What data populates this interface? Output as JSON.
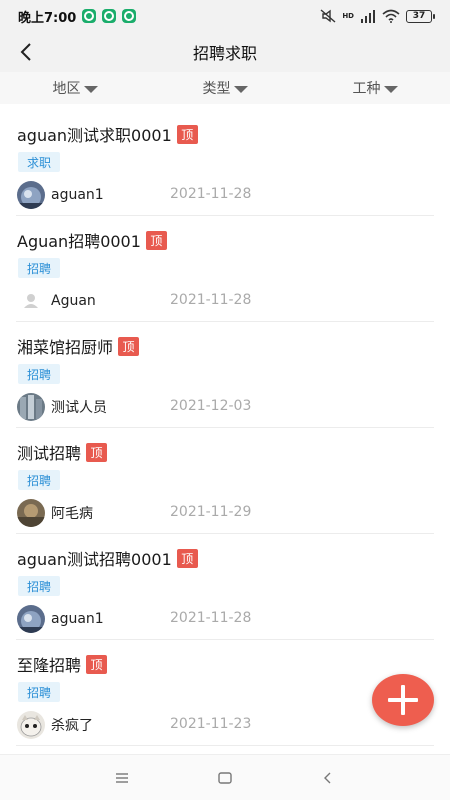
{
  "status_bar": {
    "time": "晚上7:00",
    "network_label": "HD",
    "battery": "37"
  },
  "header": {
    "title": "招聘求职",
    "back_icon": "back-arrow-icon"
  },
  "filters": [
    {
      "label": "地区"
    },
    {
      "label": "类型"
    },
    {
      "label": "工种"
    }
  ],
  "posts": [
    {
      "title": "aguan测试求职0001",
      "badge": "顶",
      "type": "求职",
      "author": "aguan1",
      "date": "2021-11-28",
      "avatar": "planet"
    },
    {
      "title": "Aguan招聘0001",
      "badge": "顶",
      "type": "招聘",
      "author": "Aguan",
      "date": "2021-11-28",
      "avatar": "default-person"
    },
    {
      "title": "湘菜馆招厨师",
      "badge": "顶",
      "type": "招聘",
      "author": "测试人员",
      "date": "2021-12-03",
      "avatar": "building"
    },
    {
      "title": "测试招聘",
      "badge": "顶",
      "type": "招聘",
      "author": "阿毛病",
      "date": "2021-11-29",
      "avatar": "photo"
    },
    {
      "title": "aguan测试招聘0001",
      "badge": "顶",
      "type": "招聘",
      "author": "aguan1",
      "date": "2021-11-28",
      "avatar": "planet"
    },
    {
      "title": "至隆招聘",
      "badge": "顶",
      "type": "招聘",
      "author": "杀疯了",
      "date": "2021-11-23",
      "avatar": "cat"
    }
  ],
  "fab": {
    "icon": "plus-icon"
  },
  "colors": {
    "badge": "#e85a4f",
    "tag_bg": "#e6f3fb",
    "tag_text": "#2b8fd6",
    "fab": "#ee5e4f",
    "date": "#aaaaaa"
  }
}
